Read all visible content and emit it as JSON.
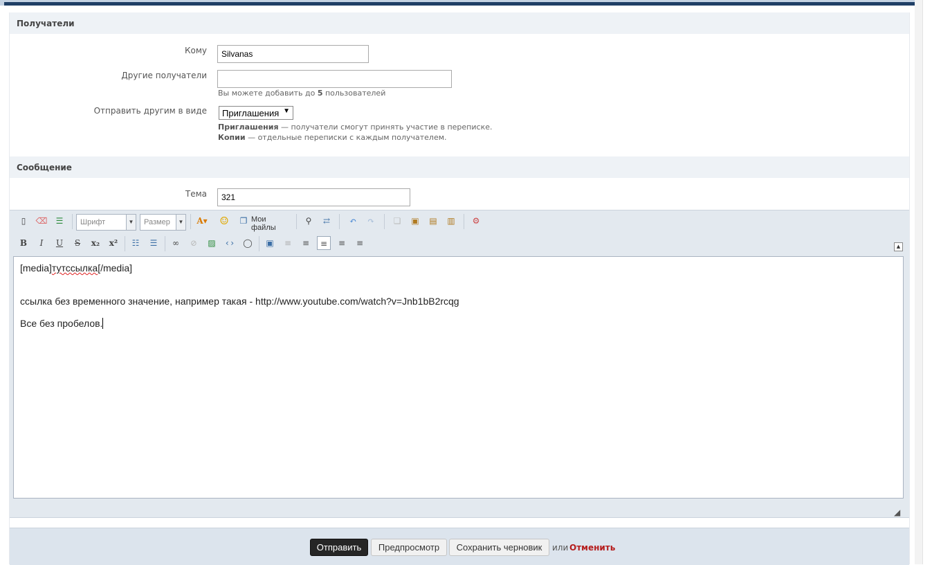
{
  "recipients": {
    "heading": "Получатели",
    "to_label": "Кому",
    "to_value": "Silvanas",
    "others_label": "Другие получатели",
    "others_value": "",
    "others_hint_prefix": "Вы можете добавить до ",
    "others_hint_count": "5",
    "others_hint_suffix": " пользователей",
    "send_as_label": "Отправить другим в виде",
    "send_as_value": "Приглашения",
    "invite_term": "Приглашения",
    "invite_desc": " — получатели смогут принять участие в переписке.",
    "copies_term": "Копии",
    "copies_desc": " — отдельные переписки с каждым получателем."
  },
  "message": {
    "heading": "Сообщение",
    "subject_label": "Тема",
    "subject_value": "321",
    "toolbar": {
      "font_placeholder": "Шрифт",
      "size_placeholder": "Размер",
      "my_files_label": "Мои файлы"
    },
    "body": {
      "line1_open": "[media]",
      "line1_word": "тутссылка",
      "line1_close": "[/media]",
      "line2": "ссылка без временного значение, например такая - http://www.youtube.com/watch?v=Jnb1bB2rcqg",
      "line3": "Все без пробелов."
    }
  },
  "footer": {
    "submit_label": "Отправить",
    "preview_label": "Предпросмотр",
    "draft_label": "Сохранить черновик",
    "or_text": "или",
    "cancel_label": "Отменить"
  },
  "colors": {
    "header_bg": "#eef2f6",
    "editor_bg": "#e3e9ef",
    "primary_button": "#262626",
    "cancel_link": "#b51c1c"
  }
}
